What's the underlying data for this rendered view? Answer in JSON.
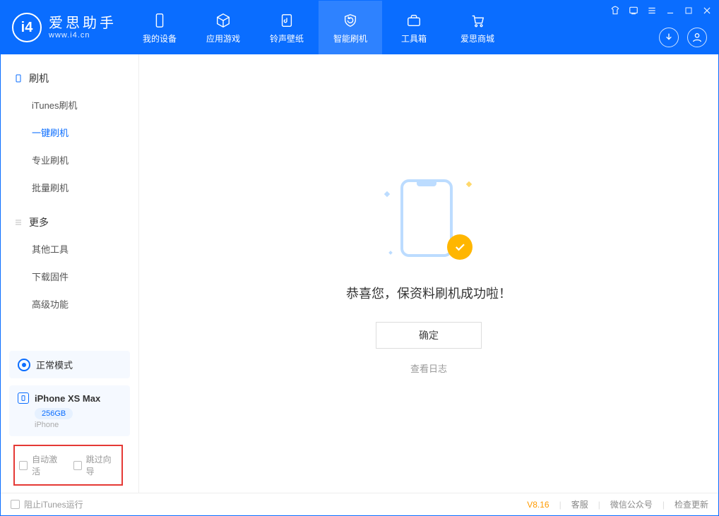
{
  "app": {
    "name_cn": "爱思助手",
    "name_en": "www.i4.cn"
  },
  "header": {
    "tabs": [
      {
        "label": "我的设备"
      },
      {
        "label": "应用游戏"
      },
      {
        "label": "铃声壁纸"
      },
      {
        "label": "智能刷机"
      },
      {
        "label": "工具箱"
      },
      {
        "label": "爱思商城"
      }
    ]
  },
  "sidebar": {
    "group1": {
      "title": "刷机",
      "items": [
        {
          "label": "iTunes刷机"
        },
        {
          "label": "一键刷机"
        },
        {
          "label": "专业刷机"
        },
        {
          "label": "批量刷机"
        }
      ]
    },
    "group2": {
      "title": "更多",
      "items": [
        {
          "label": "其他工具"
        },
        {
          "label": "下载固件"
        },
        {
          "label": "高级功能"
        }
      ]
    },
    "status": {
      "label": "正常模式"
    },
    "device": {
      "name": "iPhone XS Max",
      "capacity": "256GB",
      "type": "iPhone"
    },
    "options": {
      "auto_activate": "自动激活",
      "skip_guide": "跳过向导"
    }
  },
  "main": {
    "success_msg": "恭喜您，保资料刷机成功啦！",
    "ok_label": "确定",
    "log_link": "查看日志"
  },
  "footer": {
    "block_itunes": "阻止iTunes运行",
    "version": "V8.16",
    "support": "客服",
    "wechat": "微信公众号",
    "update": "检查更新"
  }
}
